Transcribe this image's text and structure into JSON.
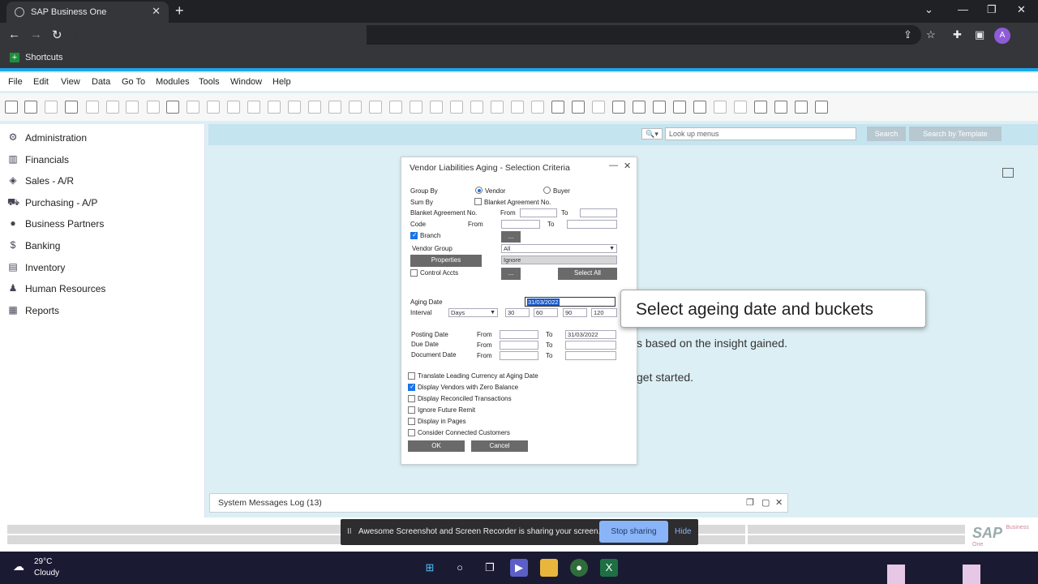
{
  "browser": {
    "tab_title": "SAP Business One",
    "tab_close": "✕",
    "new_tab": "+",
    "bookmark": "Shortcuts",
    "avatar": "A"
  },
  "menu": [
    "File",
    "Edit",
    "View",
    "Data",
    "Go To",
    "Modules",
    "Tools",
    "Window",
    "Help"
  ],
  "nav": [
    {
      "label": "Administration",
      "icon": "gear-icon"
    },
    {
      "label": "Financials",
      "icon": "chart-icon"
    },
    {
      "label": "Sales - A/R",
      "icon": "tag-icon"
    },
    {
      "label": "Purchasing - A/P",
      "icon": "cart-icon"
    },
    {
      "label": "Business Partners",
      "icon": "person-icon"
    },
    {
      "label": "Banking",
      "icon": "dollar-icon"
    },
    {
      "label": "Inventory",
      "icon": "inventory-icon"
    },
    {
      "label": "Human Resources",
      "icon": "people-icon"
    },
    {
      "label": "Reports",
      "icon": "report-icon"
    }
  ],
  "search": {
    "picker": "🔍▾",
    "placeholder": "Look up menus",
    "search_btn": "Search",
    "template_btn": "Search by Template"
  },
  "background_text": {
    "line1": "s based on the insight gained.",
    "line2": "get started."
  },
  "dialog": {
    "title": "Vendor Liabilities Aging - Selection Criteria",
    "min": "—",
    "close": "✕",
    "group_by": "Group By",
    "vendor": "Vendor",
    "buyer": "Buyer",
    "sum_by": "Sum By",
    "blanket_chk": "Blanket Agreement No.",
    "blanket_label": "Blanket Agreement No.",
    "from": "From",
    "to": "To",
    "code": "Code",
    "branch": "Branch",
    "ellipsis": "...",
    "vendor_group": "Vendor Group",
    "vendor_group_value": "All",
    "properties": "Properties",
    "ignore": "Ignore",
    "control_accts": "Control Accts",
    "select_all": "Select All",
    "aging_date": "Aging Date",
    "aging_date_value": "31/03/2022",
    "interval": "Interval",
    "interval_unit": "Days",
    "buckets": [
      "30",
      "60",
      "90",
      "120"
    ],
    "posting_date": "Posting Date",
    "posting_to_value": "31/03/2022",
    "due_date": "Due Date",
    "document_date": "Document Date",
    "options": [
      {
        "label": "Translate Leading Currency at Aging Date",
        "checked": false
      },
      {
        "label": "Display Vendors with Zero Balance",
        "checked": true
      },
      {
        "label": "Display Reconciled Transactions",
        "checked": false
      },
      {
        "label": "Ignore Future Remit",
        "checked": false
      },
      {
        "label": "Display in Pages",
        "checked": false
      },
      {
        "label": "Consider Connected Customers",
        "checked": false
      }
    ],
    "ok": "OK",
    "cancel": "Cancel"
  },
  "callout": "Select ageing date and buckets",
  "messages_log": "System Messages Log (13)",
  "share": {
    "pause": "II",
    "text": "Awesome Screenshot and Screen Recorder is sharing your screen.",
    "stop": "Stop sharing",
    "hide": "Hide"
  },
  "sap_logo": "SAP",
  "sap_logo_sub": "Business One",
  "weather": {
    "temp": "29°C",
    "condition": "Cloudy"
  }
}
